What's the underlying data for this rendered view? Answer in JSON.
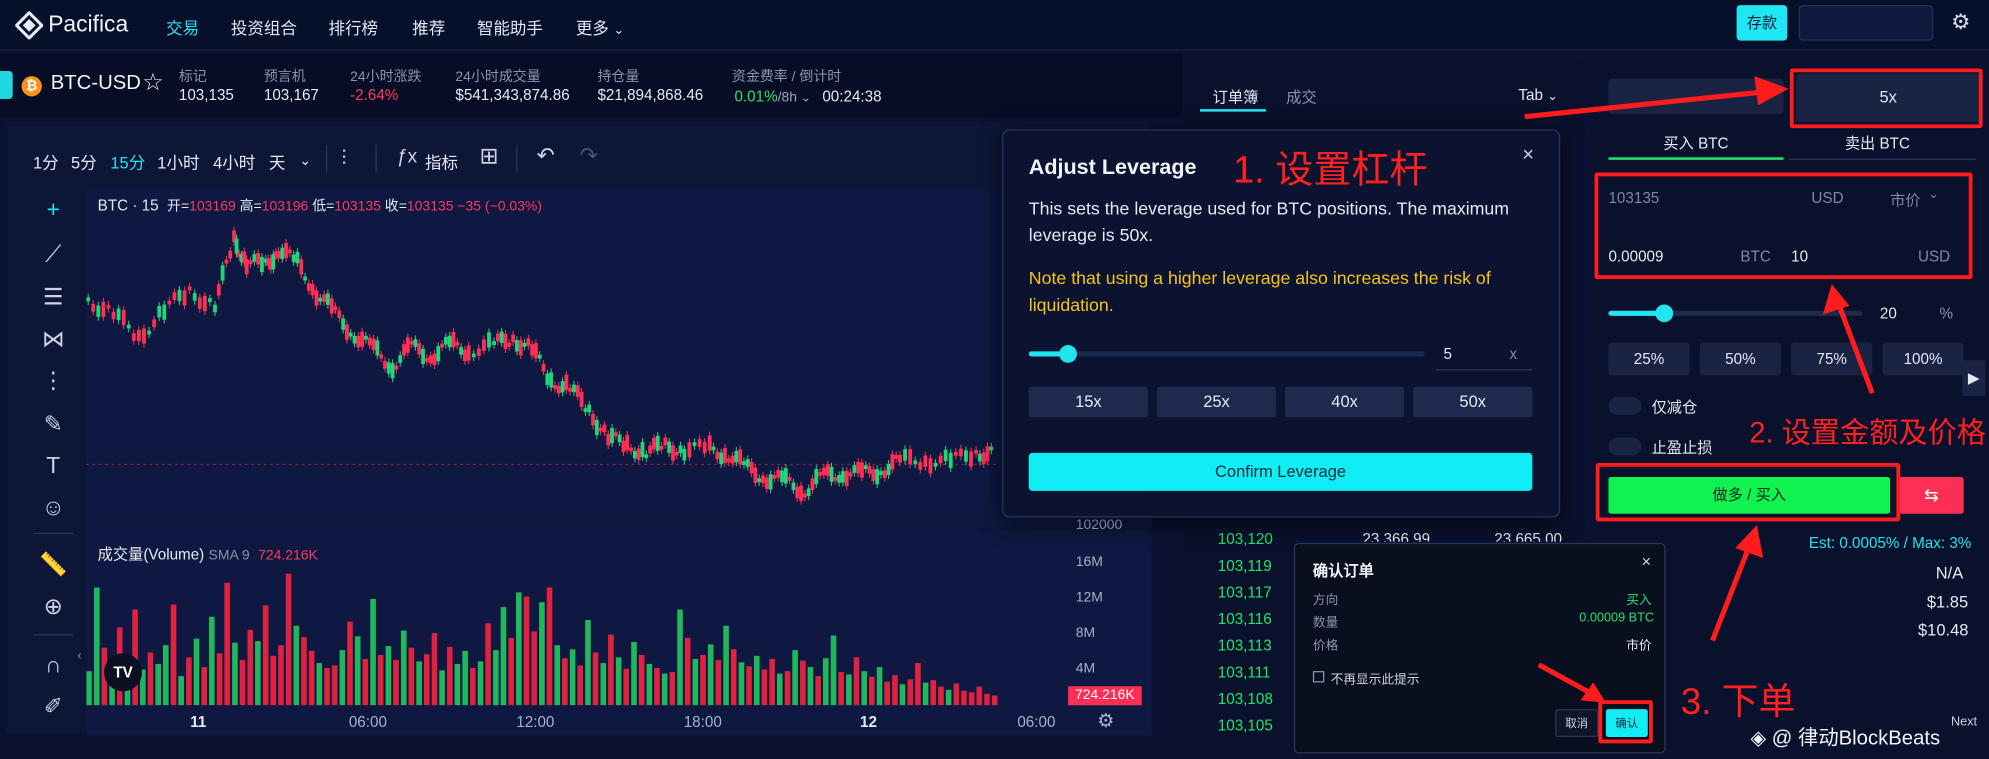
{
  "nav": {
    "logo_text": "Pacifica",
    "items": [
      "交易",
      "投资组合",
      "排行榜",
      "推荐",
      "智能助手",
      "更多"
    ],
    "deposit_label": "存款"
  },
  "ticker": {
    "symbol": "BTC-USD",
    "stats": [
      {
        "label": "标记",
        "value": "103,135"
      },
      {
        "label": "预言机",
        "value": "103,167"
      },
      {
        "label": "24小时涨跌",
        "value": "-2.64%"
      },
      {
        "label": "24小时成交量",
        "value": "$541,343,874.86"
      },
      {
        "label": "持仓量",
        "value": "$21,894,868.46"
      }
    ],
    "funding_label": "资金费率 / 倒计时",
    "funding_rate": "0.01%",
    "funding_period": "/8h",
    "countdown": "00:24:38"
  },
  "chart_toolbar": {
    "timeframes": [
      "1分",
      "5分",
      "15分",
      "1小时",
      "4小时",
      "天"
    ],
    "indicators_label": "指标"
  },
  "chart": {
    "legend_title": "BTC · 15",
    "ohlc": [
      {
        "k": "开=",
        "v": "103169"
      },
      {
        "k": "高=",
        "v": "103196"
      },
      {
        "k": "低=",
        "v": "103135"
      },
      {
        "k": "收=",
        "v": "103135"
      }
    ],
    "change": "−35 (−0.03%)",
    "volume_label": "成交量(Volume)",
    "volume_sma": "SMA 9",
    "volume_value": "724.216K",
    "price_scale_cut": "102000",
    "volume_axis": [
      "16M",
      "12M",
      "8M",
      "4M"
    ],
    "volume_last_badge": "724.216K",
    "time_axis": [
      "11",
      "06:00",
      "12:00",
      "18:00",
      "12",
      "06:00"
    ]
  },
  "chart_data": {
    "type": "bar",
    "title": "成交量(Volume)",
    "ylim": [
      0,
      20000000
    ],
    "values": [
      4.2,
      14.5,
      7.1,
      5.3,
      9.6,
      6.2,
      11.8,
      4.4,
      6.5,
      5.1,
      7.4,
      12.4,
      3.6,
      5.9,
      8.2,
      4.7,
      10.9,
      6.4,
      15.1,
      7.7,
      5.6,
      9.3,
      7.9,
      12.3,
      6.1,
      7.4,
      16.2,
      9.8,
      8.4,
      6.7,
      5.2,
      4.6,
      4.9,
      6.8,
      10.3,
      8.5,
      5.7,
      13.1,
      6.2,
      7.3,
      5.6,
      9.2,
      7.1,
      5.4,
      6.3,
      8.9,
      4.3,
      7.2,
      5.1,
      6.7,
      4.6,
      5.4,
      10.1,
      6.8,
      12.1,
      8.3,
      13.9,
      13.4,
      9.1,
      12.7,
      14.5,
      7.4,
      5.8,
      6.9,
      4.9,
      10.5,
      6.5,
      5.2,
      8.7,
      5.9,
      4.5,
      7.8,
      6.2,
      5.1,
      4.6,
      3.9,
      4.1,
      11.8,
      8.3,
      5.7,
      6.2,
      7.5,
      5.6,
      9.8,
      6.9,
      5.3,
      4.8,
      6.1,
      4.4,
      5.7,
      3.9,
      4.2,
      6.8,
      5.5,
      4.7,
      3.6,
      5.8,
      8.6,
      4.1,
      3.8,
      5.9,
      4.2,
      3.5,
      4.7,
      2.9,
      3.7,
      2.6,
      3.2,
      5.2,
      2.8,
      3.1,
      2.3,
      1.9,
      2.7,
      1.8,
      1.6,
      2.3,
      1.4,
      1.2
    ],
    "colors": "ggrgrgrgrggrgrgrgrrgrrgrrrrgrrgrrgrgrgrgrgrgrrgrggrgrggrgrrgrgrgrgrgrgrgrgrgrgrgrgrgrgrgrrgrgrgrggrgrgrgrrgrrgrrgrrr"
  },
  "orderbook": {
    "tabs": [
      "订单簿",
      "成交"
    ],
    "tab_right": "Tab",
    "prices": [
      "103,120",
      "103,119",
      "103,117",
      "103,116",
      "103,113",
      "103,111",
      "103,108",
      "103,105"
    ],
    "partial_sizes": [
      "23,366.99",
      "23,665.00"
    ]
  },
  "modal": {
    "title": "Adjust Leverage",
    "desc": "This sets the leverage used for BTC positions. The maximum leverage is 50x.",
    "warning": "Note that using a higher leverage also increases the risk of liquidation.",
    "slider_value": "5",
    "suffix": "x",
    "level": 0.08,
    "presets": [
      "15x",
      "25x",
      "40x",
      "50x"
    ],
    "confirm_label": "Confirm Leverage"
  },
  "trade": {
    "leverage_label": "5x",
    "sides": [
      "买入 BTC",
      "卖出 BTC"
    ],
    "price_value": "103135",
    "price_unit": "USD",
    "order_type": "市价",
    "qty_value": "0.00009",
    "qty_unit": "BTC",
    "usd_value": "10",
    "usd_unit": "USD",
    "slider_value": "20",
    "slider_unit": "%",
    "level": 0.2,
    "pcts": [
      "25%",
      "50%",
      "75%",
      "100%"
    ],
    "reduce_only": "仅减仓",
    "tp_sl": "止盈止损",
    "buy_label": "做多 / 买入",
    "est_fee": "Est: 0.0005% / Max: 3%",
    "info_values": [
      "N/A",
      "$1.85",
      "$10.48"
    ]
  },
  "confirm": {
    "title": "确认订单",
    "rows": [
      {
        "k": "方向",
        "v": "买入"
      },
      {
        "k": "数量",
        "v": "0.00009 BTC"
      },
      {
        "k": "价格",
        "v": "市价"
      }
    ],
    "checkbox_label": "不再显示此提示",
    "cancel_label": "取消",
    "ok_label": "确认"
  },
  "annotations": {
    "step1": "1. 设置杠杆",
    "step2": "2. 设置金额及价格",
    "step3": "3. 下单",
    "watermark": "@ 律动BlockBeats",
    "next_label": "Next"
  }
}
